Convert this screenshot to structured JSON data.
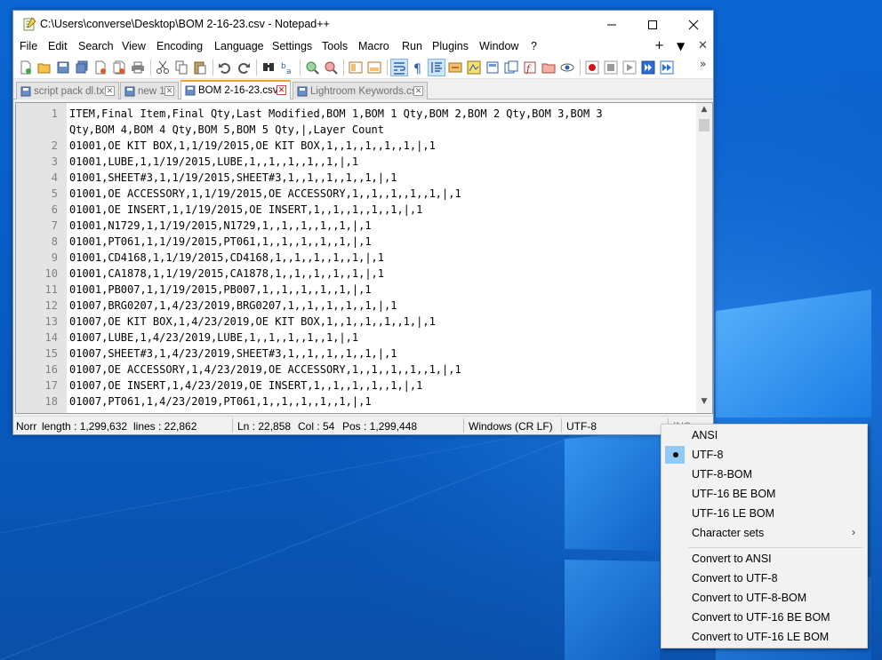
{
  "window": {
    "title": "C:\\Users\\converse\\Desktop\\BOM 2-16-23.csv - Notepad++",
    "controls": {
      "minimize": "—",
      "maximize": "☐",
      "close": "✕"
    }
  },
  "menu": {
    "items": [
      "File",
      "Edit",
      "Search",
      "View",
      "Encoding",
      "Language",
      "Settings",
      "Tools",
      "Macro",
      "Run",
      "Plugins",
      "Window",
      "?"
    ],
    "right": {
      "plus": "+",
      "down": "▼",
      "close": "✕"
    }
  },
  "toolbar": {
    "icons": [
      "new-file",
      "open-file",
      "save",
      "save-all",
      "close",
      "close-all",
      "print",
      "cut",
      "copy",
      "paste",
      "undo",
      "redo",
      "find",
      "replace",
      "zoom-in",
      "zoom-out",
      "sync-vertical",
      "sync-horizontal",
      "word-wrap",
      "show-all-chars",
      "indent-guide",
      "user-defined-language",
      "doc-map",
      "document-list",
      "function-list",
      "folder-workspace",
      "monitoring",
      "record-macro",
      "stop-record",
      "play-macro",
      "run-macro-multiple"
    ],
    "overflow": "»"
  },
  "tabs": [
    {
      "label": "script pack dl.txt",
      "active": false
    },
    {
      "label": "new 1",
      "active": false
    },
    {
      "label": "BOM 2-16-23.csv",
      "active": true
    },
    {
      "label": "Lightroom Keywords.csv",
      "active": false
    }
  ],
  "editor": {
    "lines": [
      {
        "no": "1",
        "text": "ITEM,Final Item,Final Qty,Last Modified,BOM 1,BOM 1 Qty,BOM 2,BOM 2 Qty,BOM 3,BOM 3"
      },
      {
        "no": "",
        "text": "Qty,BOM 4,BOM 4 Qty,BOM 5,BOM 5 Qty,|,Layer Count"
      },
      {
        "no": "2",
        "text": "01001,OE KIT BOX,1,1/19/2015,OE KIT BOX,1,,1,,1,,1,,1,|,1"
      },
      {
        "no": "3",
        "text": "01001,LUBE,1,1/19/2015,LUBE,1,,1,,1,,1,,1,|,1"
      },
      {
        "no": "4",
        "text": "01001,SHEET#3,1,1/19/2015,SHEET#3,1,,1,,1,,1,,1,|,1"
      },
      {
        "no": "5",
        "text": "01001,OE ACCESSORY,1,1/19/2015,OE ACCESSORY,1,,1,,1,,1,,1,|,1"
      },
      {
        "no": "6",
        "text": "01001,OE INSERT,1,1/19/2015,OE INSERT,1,,1,,1,,1,,1,|,1"
      },
      {
        "no": "7",
        "text": "01001,N1729,1,1/19/2015,N1729,1,,1,,1,,1,,1,|,1"
      },
      {
        "no": "8",
        "text": "01001,PT061,1,1/19/2015,PT061,1,,1,,1,,1,,1,|,1"
      },
      {
        "no": "9",
        "text": "01001,CD4168,1,1/19/2015,CD4168,1,,1,,1,,1,,1,|,1"
      },
      {
        "no": "10",
        "text": "01001,CA1878,1,1/19/2015,CA1878,1,,1,,1,,1,,1,|,1"
      },
      {
        "no": "11",
        "text": "01001,PB007,1,1/19/2015,PB007,1,,1,,1,,1,,1,|,1"
      },
      {
        "no": "12",
        "text": "01007,BRG0207,1,4/23/2019,BRG0207,1,,1,,1,,1,,1,|,1"
      },
      {
        "no": "13",
        "text": "01007,OE KIT BOX,1,4/23/2019,OE KIT BOX,1,,1,,1,,1,,1,|,1"
      },
      {
        "no": "14",
        "text": "01007,LUBE,1,4/23/2019,LUBE,1,,1,,1,,1,,1,|,1"
      },
      {
        "no": "15",
        "text": "01007,SHEET#3,1,4/23/2019,SHEET#3,1,,1,,1,,1,,1,|,1"
      },
      {
        "no": "16",
        "text": "01007,OE ACCESSORY,1,4/23/2019,OE ACCESSORY,1,,1,,1,,1,,1,|,1"
      },
      {
        "no": "17",
        "text": "01007,OE INSERT,1,4/23/2019,OE INSERT,1,,1,,1,,1,,1,|,1"
      },
      {
        "no": "18",
        "text": "01007,PT061,1,4/23/2019,PT061,1,,1,,1,,1,,1,|,1"
      }
    ]
  },
  "status_bar": {
    "lang": "Norr",
    "length": "length : 1,299,632",
    "lines": "lines : 22,862",
    "ln": "Ln : 22,858",
    "col": "Col : 54",
    "pos": "Pos : 1,299,448",
    "eol": "Windows (CR LF)",
    "encoding": "UTF-8",
    "ins": "INS"
  },
  "encoding_menu": {
    "items": [
      {
        "label": "ANSI",
        "checked": false
      },
      {
        "label": "UTF-8",
        "checked": true
      },
      {
        "label": "UTF-8-BOM",
        "checked": false
      },
      {
        "label": "UTF-16 BE BOM",
        "checked": false
      },
      {
        "label": "UTF-16 LE BOM",
        "checked": false
      },
      {
        "label": "Character sets",
        "checked": false,
        "submenu": true
      }
    ],
    "convert_items": [
      "Convert to ANSI",
      "Convert to UTF-8",
      "Convert to UTF-8-BOM",
      "Convert to UTF-16 BE BOM",
      "Convert to UTF-16 LE BOM"
    ],
    "submenu_arrow": "›"
  },
  "colors": {
    "desktop": "#0a5ec7",
    "active_tab_accent": "#f0a030",
    "menu_highlight": "#90c8f6"
  }
}
